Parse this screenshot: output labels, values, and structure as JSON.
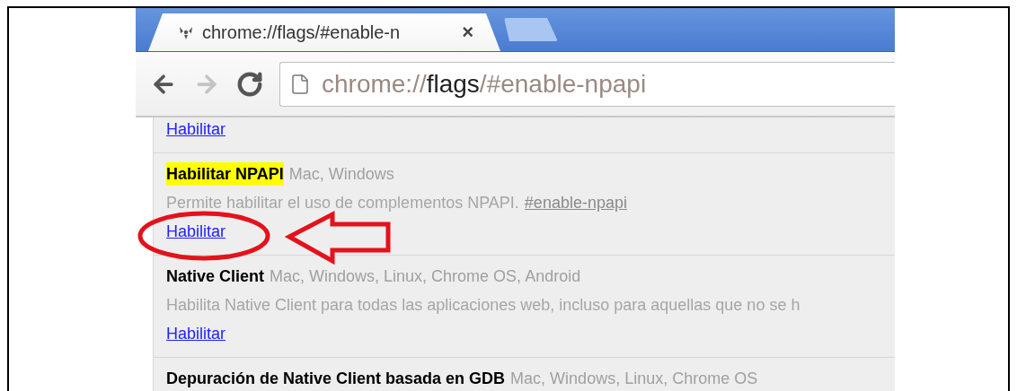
{
  "tabs": [
    {
      "title": "chrome://flags/#enable-n",
      "close": "×",
      "selected": true
    }
  ],
  "toolbar": {
    "back": {
      "disabled": false
    },
    "forward": {
      "disabled": true
    }
  },
  "address_bar": {
    "scheme": "chrome://",
    "host": "flags",
    "path": "/#enable-npapi"
  },
  "flags": [
    {
      "link": "Habilitar"
    },
    {
      "title": "Habilitar NPAPI",
      "highlighted": true,
      "platforms": "Mac, Windows",
      "description": "Permite habilitar el uso de complementos NPAPI.",
      "anchor": "#enable-npapi",
      "link": "Habilitar",
      "annotated": true
    },
    {
      "title": "Native Client",
      "highlighted": false,
      "platforms": "Mac, Windows, Linux, Chrome OS, Android",
      "description": "Habilita Native Client para todas las aplicaciones web, incluso para aquellas que no se h",
      "link": "Habilitar",
      "annotated": false
    },
    {
      "title": "Depuración de Native Client basada en GDB",
      "highlighted": false,
      "platforms": "Mac, Windows, Linux, Chrome OS"
    }
  ]
}
